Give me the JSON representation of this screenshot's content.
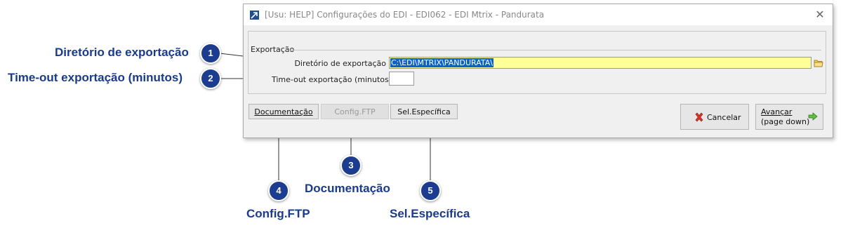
{
  "window": {
    "title": "[Usu: HELP] Configurações do EDI - EDI062 - EDI Mtrix - Pandurata",
    "close_glyph": "✕"
  },
  "group": {
    "label": "Exportação"
  },
  "fields": {
    "dir_label": "Diretório  de exportação",
    "dir_value": "C:\\EDI\\MTRIX\\PANDURATA\\",
    "timeout_label": "Time-out exportação (minutos)",
    "timeout_value": ""
  },
  "buttons": {
    "documentacao": "Documentação",
    "config_ftp": "Config.FTP",
    "sel_especifica": "Sel.Específica",
    "cancelar": "Cancelar",
    "avancar_line1": "Avançar",
    "avancar_line2": "(page down)"
  },
  "annotations": [
    {
      "number": "1",
      "label": "Diretório de exportação"
    },
    {
      "number": "2",
      "label": "Time-out exportação (minutos)"
    },
    {
      "number": "3",
      "label": "Documentação"
    },
    {
      "number": "4",
      "label": "Config.FTP"
    },
    {
      "number": "5",
      "label": "Sel.Específica"
    }
  ],
  "icons": {
    "app": "app-logo-icon",
    "folder": "folder-icon",
    "cancel": "red-x-icon",
    "next": "green-arrow-right-icon"
  },
  "colors": {
    "annotation": "#1b3c8f",
    "dir_field_bg": "#ffff99",
    "selection": "#0a64c8"
  }
}
